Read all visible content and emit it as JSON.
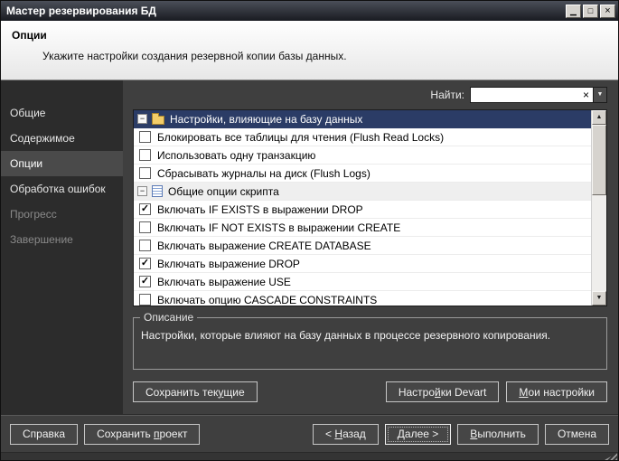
{
  "window": {
    "title": "Мастер резервирования БД"
  },
  "window_controls": {
    "minimize": "▁",
    "maximize": "□",
    "close": "×"
  },
  "header": {
    "title": "Опции",
    "subtitle": "Укажите настройки создания резервной копии базы данных."
  },
  "sidebar": {
    "items": [
      {
        "label": "Общие"
      },
      {
        "label": "Содержимое"
      },
      {
        "label": "Опции",
        "selected": true
      },
      {
        "label": "Обработка ошибок"
      },
      {
        "label": "Прогресс",
        "disabled": true
      },
      {
        "label": "Завершение",
        "disabled": true
      }
    ]
  },
  "search": {
    "label": "Найти:",
    "value": "",
    "clear_icon": "×",
    "dropdown_icon": "▼"
  },
  "options_list": {
    "collapse_glyph": "−",
    "check_glyph": "✓",
    "groups": [
      {
        "label": "Настройки, влияющие на базу данных",
        "icon": "folder-icon",
        "selected": true,
        "items": [
          {
            "label": "Блокировать все таблицы для чтения (Flush Read Locks)",
            "checked": false
          },
          {
            "label": "Использовать одну транзакцию",
            "checked": false
          },
          {
            "label": "Сбрасывать журналы на диск (Flush Logs)",
            "checked": false
          }
        ]
      },
      {
        "label": "Общие опции скрипта",
        "icon": "script-icon",
        "selected": false,
        "items": [
          {
            "label": "Включать IF EXISTS в выражении DROP",
            "checked": true
          },
          {
            "label": "Включать IF NOT EXISTS в выражении CREATE",
            "checked": false
          },
          {
            "label": "Включать выражение CREATE DATABASE",
            "checked": false
          },
          {
            "label": "Включать выражение DROP",
            "checked": true
          },
          {
            "label": "Включать выражение USE",
            "checked": true
          },
          {
            "label": "Включать опцию CASCADE CONSTRAINTS",
            "checked": false
          }
        ]
      }
    ]
  },
  "scrollbar": {
    "up_icon": "▲",
    "down_icon": "▼"
  },
  "description": {
    "title": "Описание",
    "text": "Настройки, которые влияют на базу данных в процессе резервного копирования."
  },
  "preset_buttons": {
    "save_current": {
      "text": "Сохранить текущие",
      "accel": 13
    },
    "devart_settings": {
      "text": "Настройки Devart",
      "accel": 6
    },
    "my_settings": {
      "text": "Мои настройки",
      "accel": 0
    }
  },
  "footer_buttons": {
    "help": {
      "text": "Справка",
      "accel": -1
    },
    "save_project": {
      "text": "Сохранить проект",
      "accel": 10
    },
    "back": {
      "text": "< Назад",
      "accel": 2
    },
    "next": {
      "text": "Далее >",
      "accel": 0
    },
    "execute": {
      "text": "Выполнить",
      "accel": 0
    },
    "cancel": {
      "text": "Отмена",
      "accel": -1
    }
  },
  "colors": {
    "dialog_bg": "#3f3f3f",
    "sidebar_bg": "#2c2c2c",
    "selection_navy": "#2b3c66",
    "folder_yellow": "#f3cd69"
  }
}
